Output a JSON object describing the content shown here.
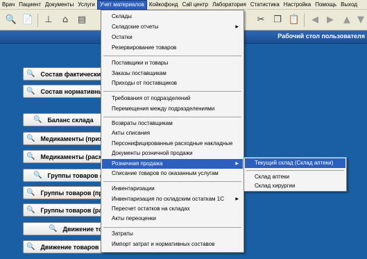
{
  "menubar": [
    "Врач",
    "Пациент",
    "Документы",
    "Услуги",
    "Учет материалов",
    "Койкофонд",
    "Call центр",
    "Лаборатория",
    "Статистика",
    "Настройка",
    "Помощь",
    "Выход"
  ],
  "header": {
    "title": "Рабочий стол пользователя"
  },
  "buttons": [
    "Состав фактический",
    "Состав нормативный",
    "Баланс склада",
    "Медикаменты (приход",
    "Медикаменты (расход",
    "Группы товаров (п",
    "Группы товаров (при",
    "Группы товаров (расх",
    "Движение тов",
    "Движение товаров по"
  ],
  "dropdown": {
    "items": [
      "Склады",
      "Складские отчеты",
      "Остатки",
      "Резервирование товаров",
      "Поставщики и товары",
      "Заказы поставщикам",
      "Приходы от поставщиков",
      "Требования от подразделений",
      "Перемещения между подразделениями",
      "Возвраты поставщикам",
      "Акты списания",
      "Персонифицированные расходные накладные",
      "Документы розничной продажи",
      "Розничная продажа",
      "Списание товаров по оказанным услугам",
      "Инвентаризации",
      "Инвентаризация по складским остаткам 1С",
      "Пересчет остатков на складах",
      "Акты переоценки",
      "Затраты",
      "Импорт затрат и нормативных составов"
    ]
  },
  "submenu": {
    "items": [
      "Текущий склад (Склад аптеки)",
      "Склад аптеки",
      "Склад хирургии"
    ]
  }
}
